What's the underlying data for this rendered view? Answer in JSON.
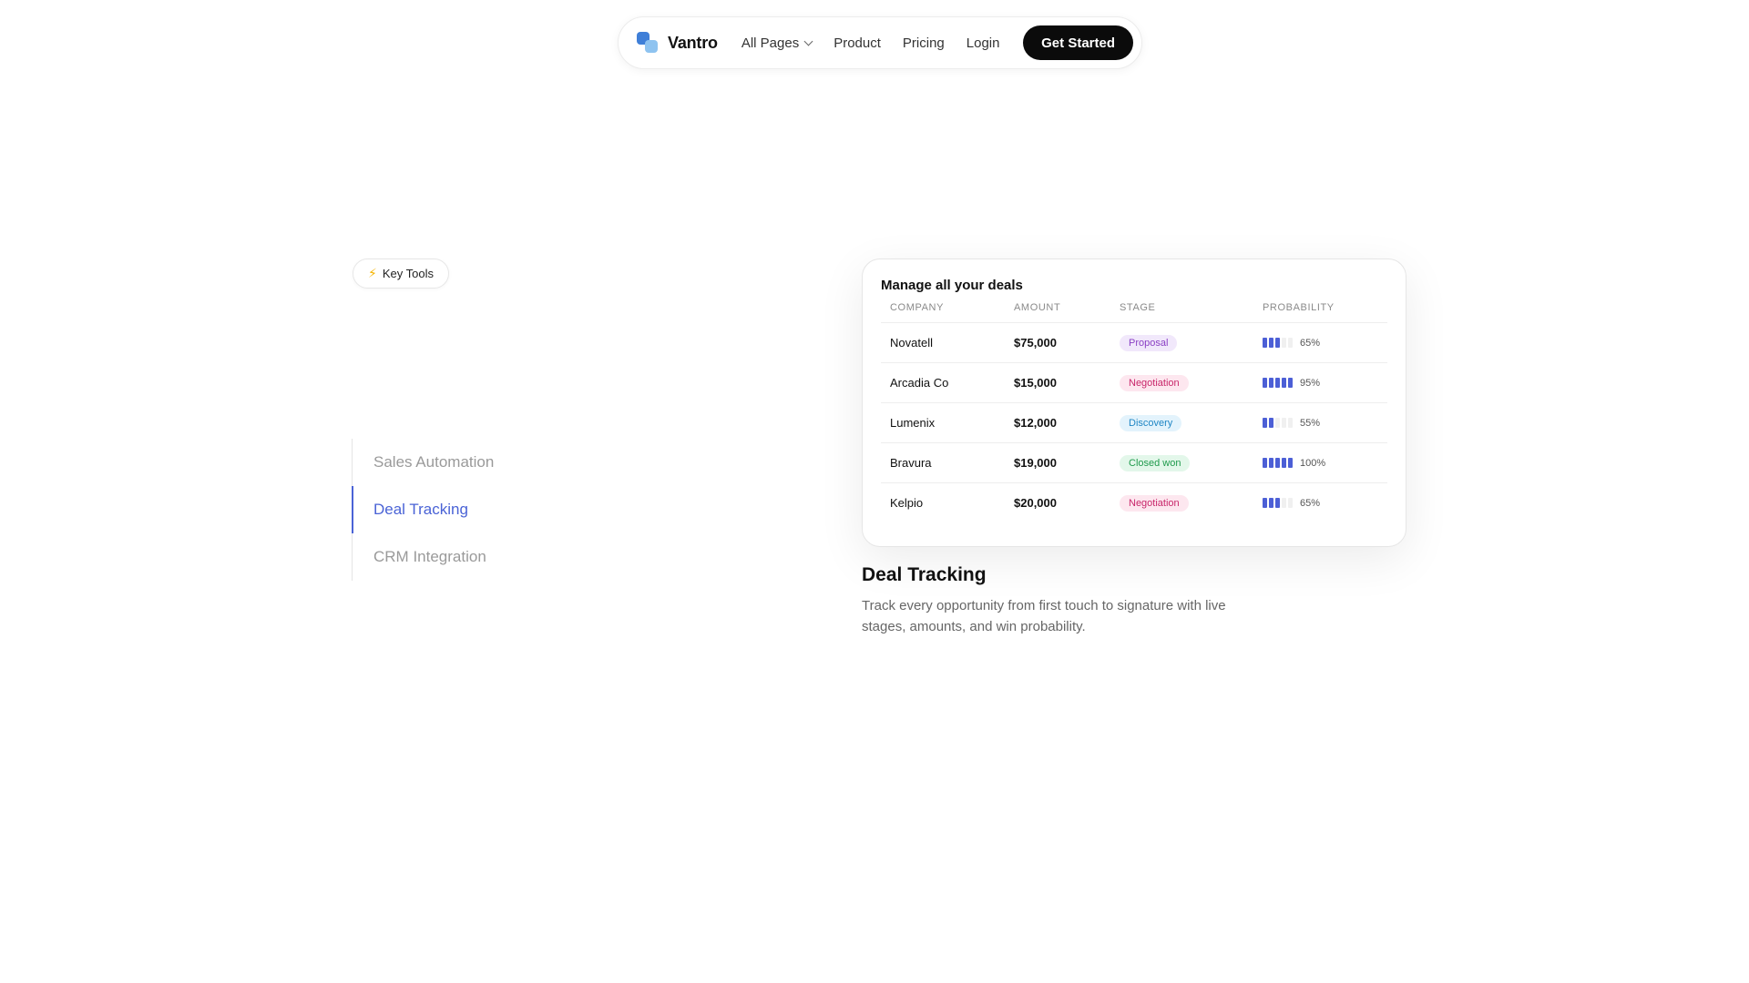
{
  "nav": {
    "brand": "Vantro",
    "all_pages": "All Pages",
    "product": "Product",
    "pricing": "Pricing",
    "login": "Login",
    "cta": "Get Started"
  },
  "badge": {
    "label": "Key Tools"
  },
  "tabs": [
    {
      "label": "Sales Automation",
      "active": false
    },
    {
      "label": "Deal Tracking",
      "active": true
    },
    {
      "label": "CRM Integration",
      "active": false
    }
  ],
  "card": {
    "title": "Manage all your deals",
    "columns": [
      "COMPANY",
      "AMOUNT",
      "STAGE",
      "PROBABILITY"
    ],
    "rows": [
      {
        "company": "Novatell",
        "amount": "$75,000",
        "stage": "Proposal",
        "probability": "65%",
        "filled": 3
      },
      {
        "company": "Arcadia Co",
        "amount": "$15,000",
        "stage": "Negotiation",
        "probability": "95%",
        "filled": 5
      },
      {
        "company": "Lumenix",
        "amount": "$12,000",
        "stage": "Discovery",
        "probability": "55%",
        "filled": 2
      },
      {
        "company": "Bravura",
        "amount": "$19,000",
        "stage": "Closed won",
        "probability": "100%",
        "filled": 5
      },
      {
        "company": "Kelpio",
        "amount": "$20,000",
        "stage": "Negotiation",
        "probability": "65%",
        "filled": 3
      }
    ]
  },
  "stage_colors": {
    "Proposal": {
      "bg": "#f1e8fb",
      "fg": "#8a3fc4"
    },
    "Negotiation": {
      "bg": "#fde7ef",
      "fg": "#c8266a"
    },
    "Discovery": {
      "bg": "#e3f3fc",
      "fg": "#1f86c4"
    },
    "Closed won": {
      "bg": "#e3f7ea",
      "fg": "#1f9a4c"
    }
  },
  "colors": {
    "accent": "#4a63d6",
    "bar_on": "#4c5fd6",
    "bar_off": "#f0f0f0"
  },
  "feature": {
    "title": "Deal Tracking",
    "description": "Track every opportunity from first touch to signature with live stages, amounts, and win probability."
  }
}
